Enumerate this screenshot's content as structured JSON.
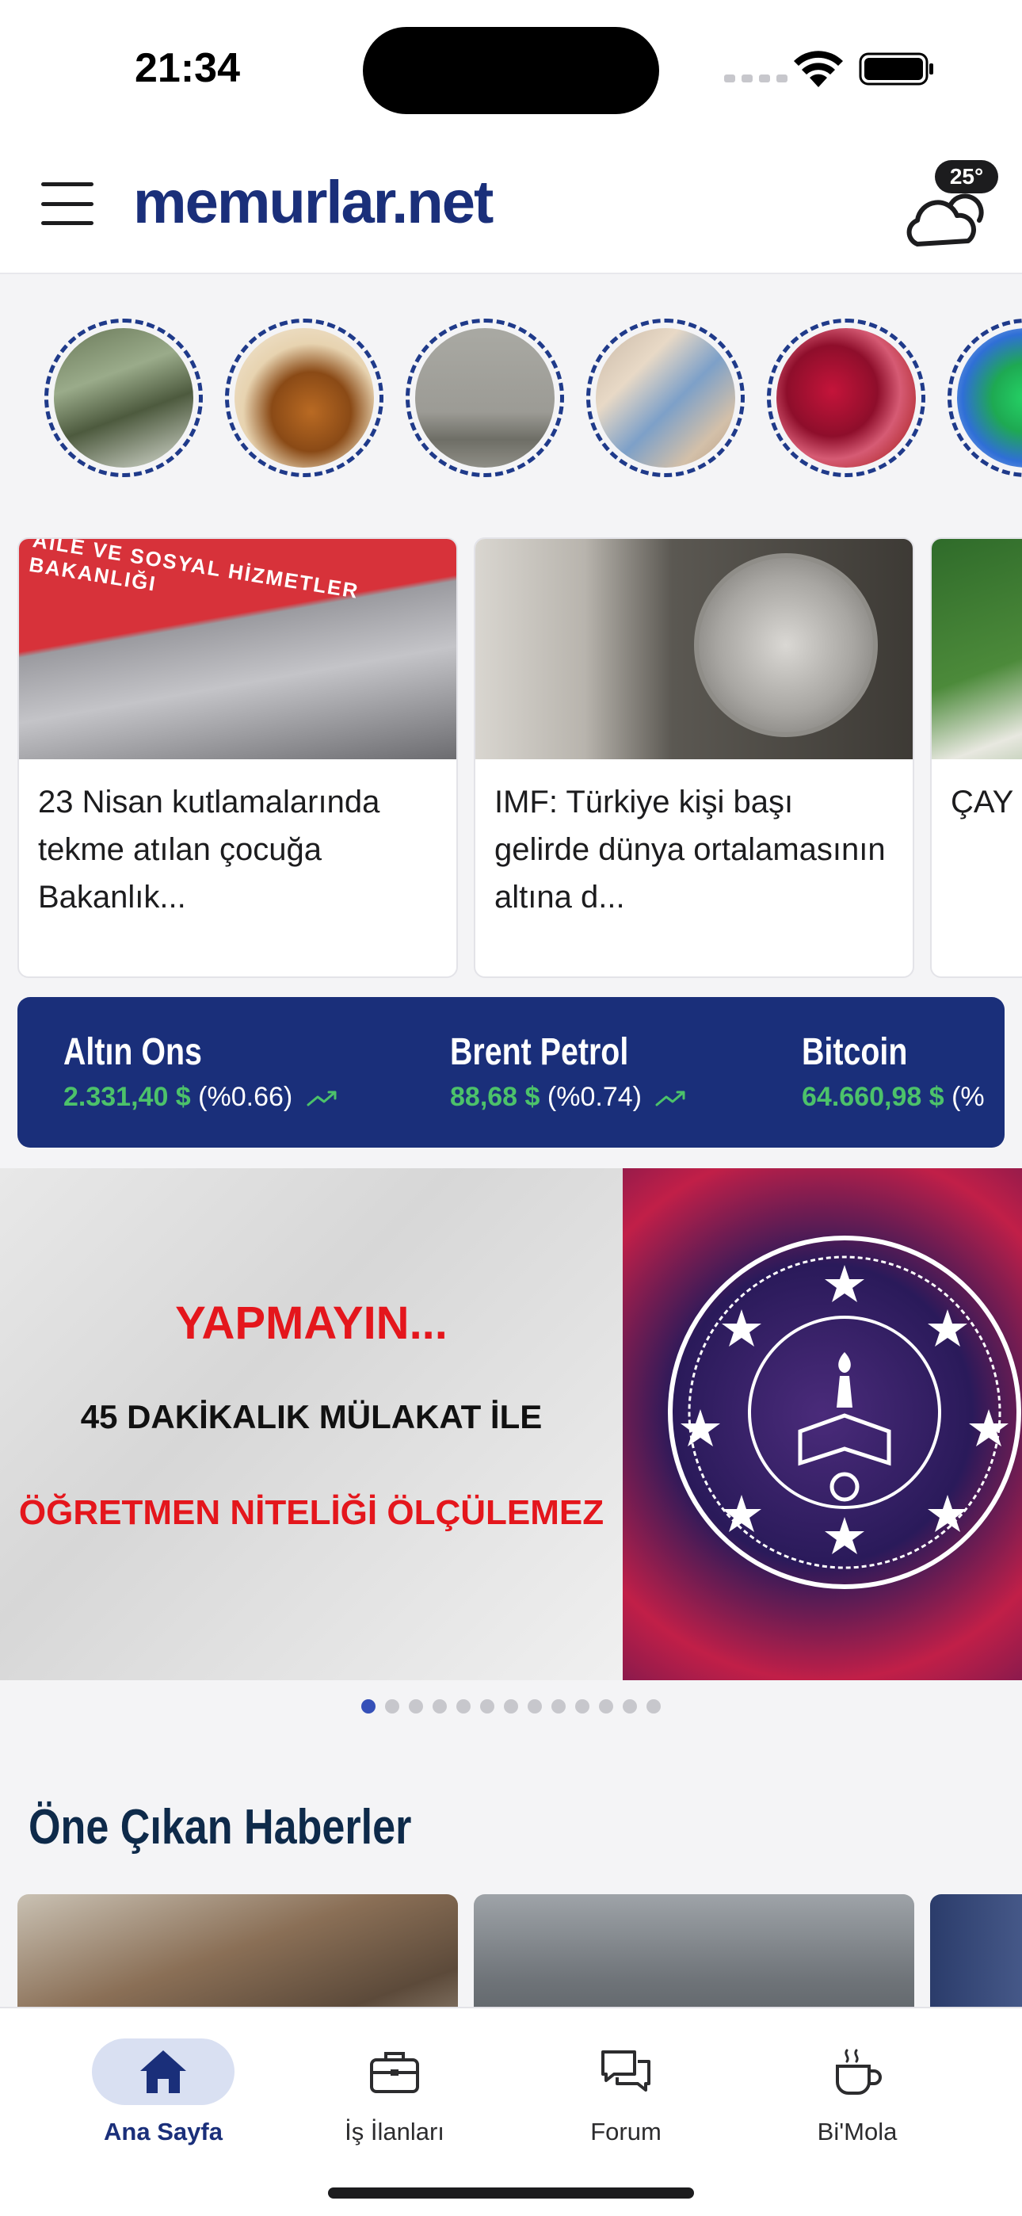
{
  "status_bar": {
    "time": "21:34"
  },
  "header": {
    "brand": "memurlar.net",
    "temperature": "25°"
  },
  "stories": [
    {
      "icon": "soldiers-photo"
    },
    {
      "icon": "pouring-liquid-photo"
    },
    {
      "icon": "foggy-city-photo"
    },
    {
      "icon": "turkish-lira-photo"
    },
    {
      "icon": "beet-juice-photo"
    },
    {
      "icon": "whatsapp-photo"
    }
  ],
  "news": [
    {
      "title": "23 Nisan kutlamalarında tekme atılan çocuğa Bakanlık...",
      "image_sign": "AİLE VE SOSYAL HİZMETLER BAKANLIĞI"
    },
    {
      "title": "IMF: Türkiye kişi başı gelirde dünya ortalamasının altına d..."
    },
    {
      "title": "ÇAY mev..."
    }
  ],
  "markets": [
    {
      "name": "Altın Ons",
      "value": "2.331,40 $",
      "change": "(%0.66)"
    },
    {
      "name": "Brent Petrol",
      "value": "88,68 $",
      "change": "(%0.74)"
    },
    {
      "name": "Bitcoin",
      "value": "64.660,98 $",
      "change": "(%"
    }
  ],
  "banner": {
    "line1": "YAPMAYIN...",
    "line2": "45 DAKİKALIK MÜLAKAT İLE",
    "line3": "ÖĞRETMEN NİTELİĞİ ÖLÇÜLEMEZ",
    "slide_count": 13,
    "active_slide": 1
  },
  "section": {
    "title": "Öne Çıkan Haberler"
  },
  "tabs": [
    {
      "label": "Ana Sayfa",
      "icon": "home-icon"
    },
    {
      "label": "İş İlanları",
      "icon": "briefcase-icon"
    },
    {
      "label": "Forum",
      "icon": "chat-icon"
    },
    {
      "label": "Bi'Mola",
      "icon": "coffee-icon"
    }
  ],
  "colors": {
    "brand": "#1a2f7a",
    "positive": "#4cc26a",
    "alert": "#e4161c"
  }
}
